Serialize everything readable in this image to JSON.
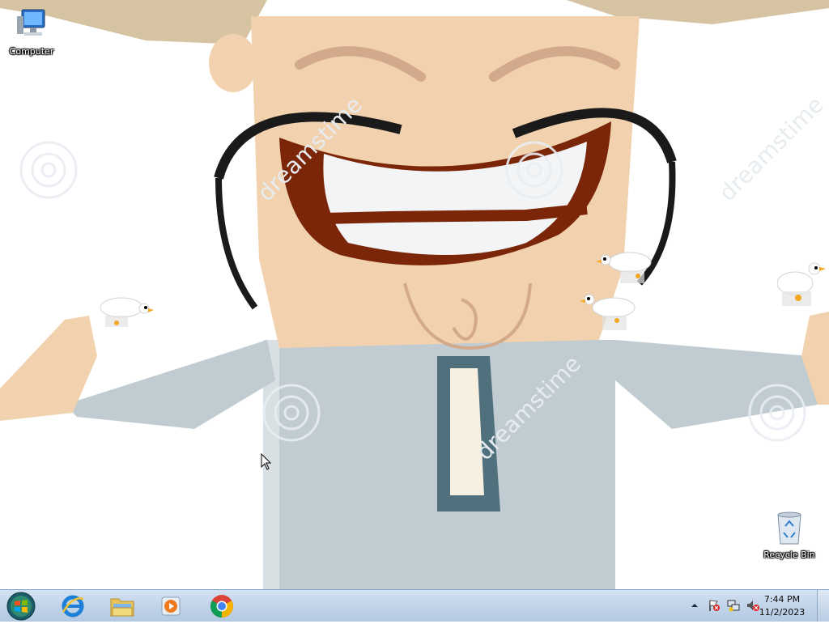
{
  "desktop": {
    "icons": [
      {
        "name": "computer",
        "label": "Computer"
      },
      {
        "name": "recycle-bin",
        "label": "Recycle Bin"
      }
    ],
    "wallpaper_watermark": "dreamstime"
  },
  "taskbar": {
    "pinned": [
      {
        "name": "internet-explorer",
        "icon": "ie-icon"
      },
      {
        "name": "windows-explorer",
        "icon": "folder-icon"
      },
      {
        "name": "media-player",
        "icon": "media-player-icon"
      },
      {
        "name": "google-chrome",
        "icon": "chrome-icon"
      }
    ],
    "tray": {
      "icons": [
        "show-hidden-icons-arrow",
        "action-center-flag-icon",
        "network-icon",
        "volume-muted-icon"
      ],
      "time": "7:44 PM",
      "date": "11/2/2023"
    }
  },
  "colors": {
    "taskbar": "#c3d5ea",
    "skin": "#f2d2ae",
    "shirt": "#c0ccd1",
    "mouth": "#7b2608",
    "hat": "#d6c3a2"
  }
}
